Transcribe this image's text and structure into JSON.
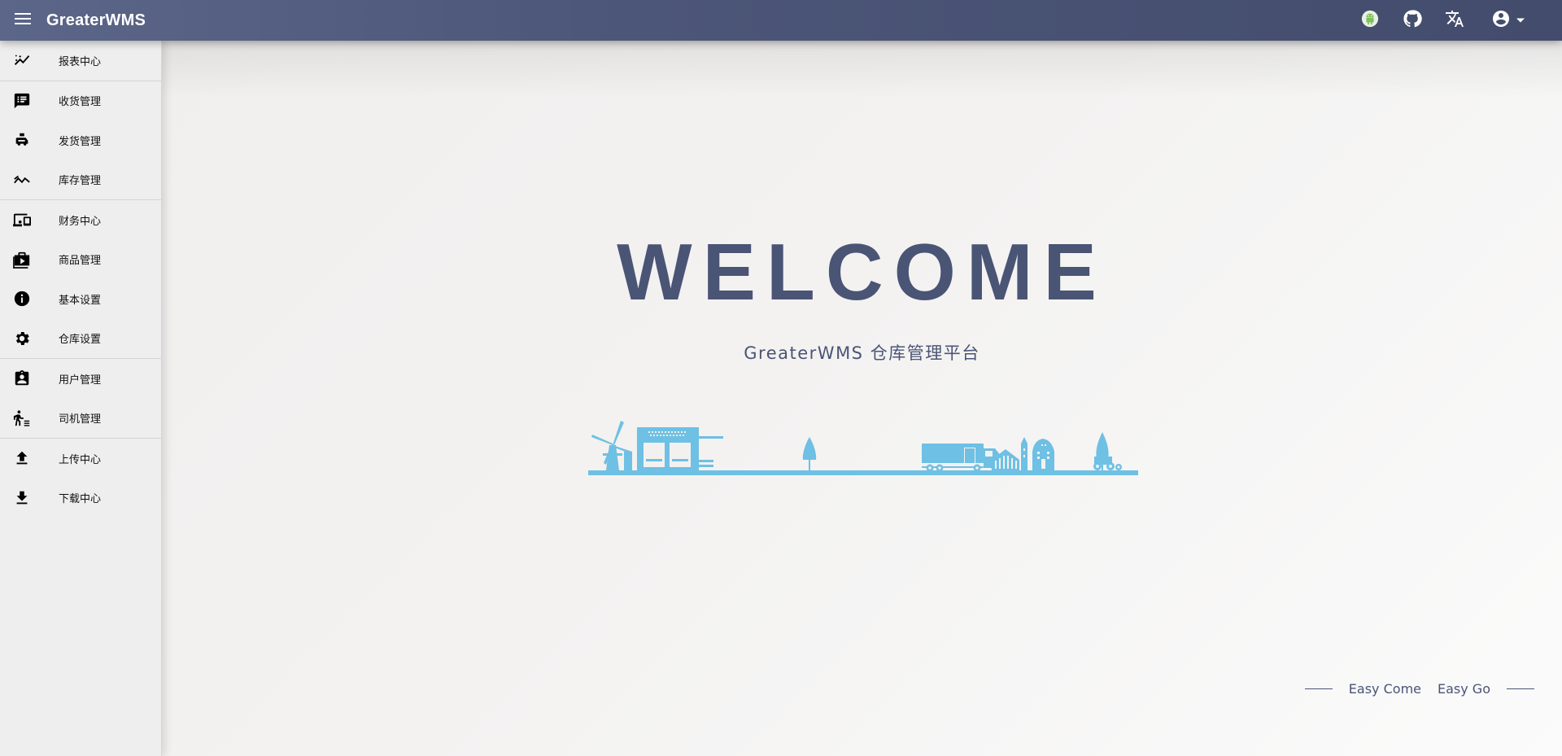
{
  "header": {
    "brand": "GreaterWMS",
    "icons": [
      "menu-icon",
      "android-icon",
      "github-icon",
      "translate-icon",
      "account-circle-icon",
      "caret-down-icon"
    ]
  },
  "sidebar": {
    "items": [
      {
        "label": "报表中心",
        "icon": "chart-line-icon"
      },
      {
        "label": "收货管理",
        "icon": "receipt-chat-icon"
      },
      {
        "label": "发货管理",
        "icon": "delivery-icon"
      },
      {
        "label": "库存管理",
        "icon": "trending-icon"
      },
      {
        "label": "财务中心",
        "icon": "devices-icon"
      },
      {
        "label": "商品管理",
        "icon": "product-bag-icon"
      },
      {
        "label": "基本设置",
        "icon": "info-icon"
      },
      {
        "label": "仓库设置",
        "icon": "gear-icon"
      },
      {
        "label": "用户管理",
        "icon": "user-badge-icon"
      },
      {
        "label": "司机管理",
        "icon": "driver-icon"
      },
      {
        "label": "上传中心",
        "icon": "upload-icon"
      },
      {
        "label": "下载中心",
        "icon": "download-icon"
      }
    ]
  },
  "main": {
    "welcome": "WELCOME",
    "subtitle": "GreaterWMS 仓库管理平台",
    "tagline_left": "Easy Come",
    "tagline_right": "Easy Go"
  },
  "colors": {
    "header": "#4c5678",
    "accent_text": "#4a5475",
    "skyline": "#6ec0e4",
    "sidebar_bg": "#efeeee"
  }
}
